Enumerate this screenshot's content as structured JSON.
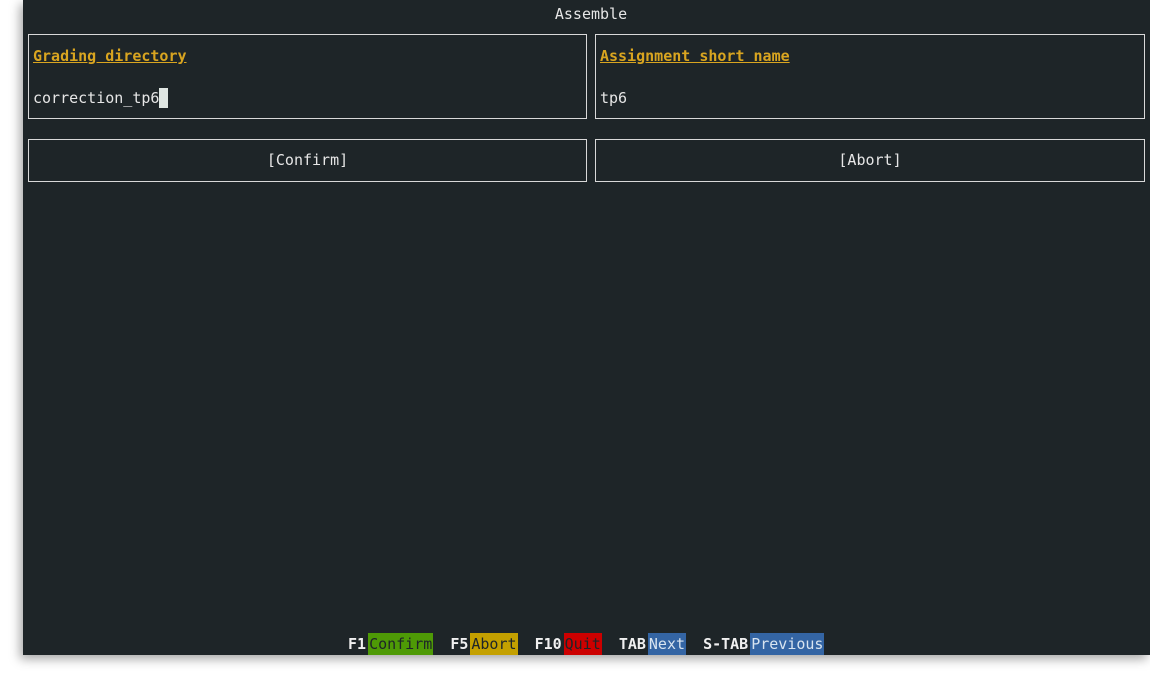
{
  "window": {
    "title": "Assemble"
  },
  "fields": [
    {
      "label": "Grading directory",
      "value": "correction_tp6"
    },
    {
      "label": "Assignment short name",
      "value": "tp6"
    }
  ],
  "buttons": {
    "confirm_label": "[Confirm]",
    "abort_label": "[Abort]"
  },
  "footer": {
    "items": [
      {
        "key": "F1",
        "action": "Confirm",
        "color": "#4e9a06"
      },
      {
        "key": "F5",
        "action": "Abort",
        "color": "#c4a000"
      },
      {
        "key": "F10",
        "action": "Quit",
        "color": "#cc0000"
      },
      {
        "key": "TAB",
        "action": "Next",
        "color": "#3465a4"
      },
      {
        "key": "S-TAB",
        "action": "Previous",
        "color": "#3465a4"
      }
    ]
  },
  "colors": {
    "background": "#1e2528",
    "label": "#d9a520",
    "border": "#d9d9d9",
    "text": "#e6e6e6"
  }
}
